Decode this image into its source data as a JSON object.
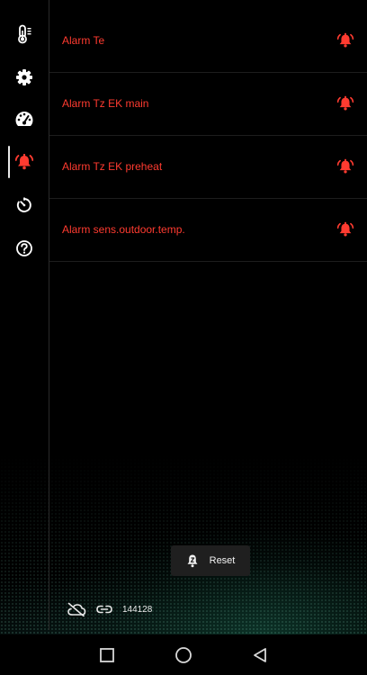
{
  "sidebar": {
    "items": [
      {
        "name": "thermometer-icon",
        "active": false
      },
      {
        "name": "gear-icon",
        "active": false
      },
      {
        "name": "gauge-icon",
        "active": false
      },
      {
        "name": "alarm-bell-icon",
        "active": true
      },
      {
        "name": "timer-icon",
        "active": false
      },
      {
        "name": "help-icon",
        "active": false
      }
    ]
  },
  "alarms": [
    {
      "label": "Alarm Te",
      "icon": "alarm-bell-icon"
    },
    {
      "label": "Alarm Tz EK main",
      "icon": "alarm-bell-icon"
    },
    {
      "label": "Alarm Tz EK preheat",
      "icon": "alarm-bell-icon"
    },
    {
      "label": "Alarm sens.outdoor.temp.",
      "icon": "alarm-bell-icon"
    }
  ],
  "reset": {
    "label": "Reset",
    "icon": "bell-clear-icon"
  },
  "status": {
    "cloud_icon": "cloud-off-icon",
    "link_icon": "link-icon",
    "id": "144128"
  },
  "android_nav": {
    "items": [
      "recent-apps-icon",
      "home-icon",
      "back-icon"
    ]
  },
  "colors": {
    "alarm": "#ff3b30",
    "background": "#000000",
    "icon": "#ffffff"
  }
}
